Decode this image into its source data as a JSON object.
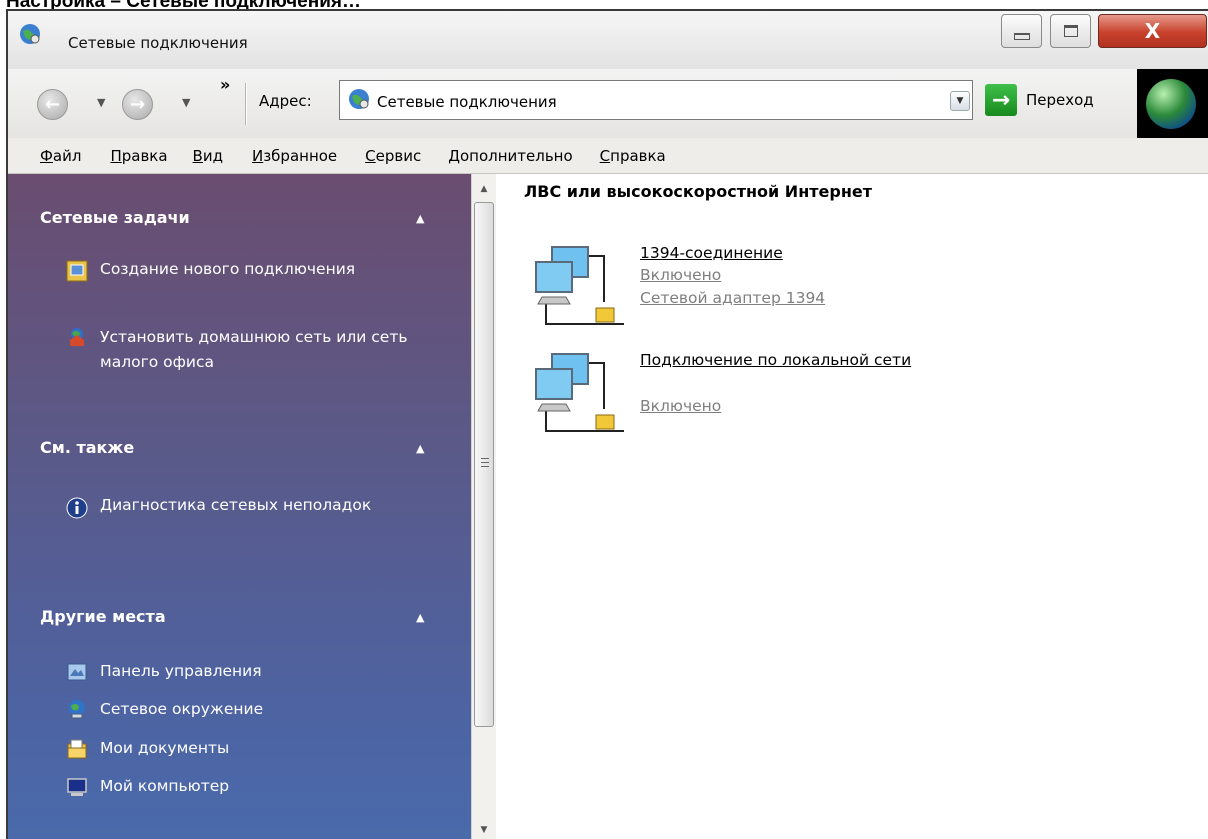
{
  "doc_heading": "Настройка – Сетевые подключения…",
  "window": {
    "title": "Сетевые подключения",
    "close_label": "X"
  },
  "toolbar": {
    "back_glyph": "←",
    "forward_glyph": "→",
    "more_glyph": "»",
    "address_label": "Адрес:",
    "address_value": "Сетевые подключения",
    "go_label": "Переход"
  },
  "menu": {
    "items": [
      "Файл",
      "Правка",
      "Вид",
      "Избранное",
      "Сервис",
      "Дополнительно",
      "Справка"
    ]
  },
  "sidebar": {
    "sections": [
      {
        "title": "Сетевые задачи",
        "links": [
          {
            "label": "Создание нового подключения",
            "icon": "new-connection-icon"
          },
          {
            "label": "Установить домашнюю сеть или сеть малого офиса",
            "icon": "home-network-wizard-icon"
          }
        ]
      },
      {
        "title": "См. также",
        "links": [
          {
            "label": "Диагностика сетевых неполадок",
            "icon": "info-icon"
          }
        ]
      },
      {
        "title": "Другие места",
        "links": [
          {
            "label": "Панель управления",
            "icon": "control-panel-icon"
          },
          {
            "label": "Сетевое окружение",
            "icon": "network-places-icon"
          },
          {
            "label": "Мои документы",
            "icon": "my-documents-icon"
          },
          {
            "label": "Мой компьютер",
            "icon": "my-computer-icon"
          }
        ]
      }
    ]
  },
  "content": {
    "group_title": "ЛВС или высокоскоростной Интернет",
    "connections": [
      {
        "name": "1394-соединение",
        "status": "Включено",
        "device": "Сетевой адаптер 1394"
      },
      {
        "name": "Подключение по локальной сети",
        "status": "Включено",
        "device": ""
      }
    ]
  },
  "colors": {
    "sidebar_top": "#6a4d70",
    "sidebar_bottom": "#4a6aab",
    "close_button": "#c9412c",
    "go_button": "#178a1d"
  }
}
